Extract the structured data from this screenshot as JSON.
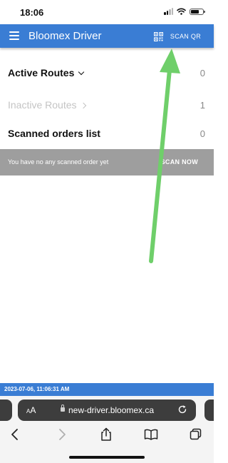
{
  "status_bar": {
    "time": "18:06",
    "icons": [
      "cellular-signal-icon",
      "wifi-icon",
      "battery-icon"
    ]
  },
  "app_bar": {
    "title": "Bloomex Driver",
    "menu_icon": "hamburger-menu-icon",
    "scan_qr_label": "SCAN QR",
    "scan_qr_icon": "qr-code-icon",
    "background_color": "#3a7dd4"
  },
  "routes": {
    "active": {
      "label": "Active Routes",
      "count": "0"
    },
    "inactive": {
      "label": "Inactive Routes",
      "count": "1"
    }
  },
  "scanned_orders": {
    "label": "Scanned orders list",
    "count": "0",
    "empty_message": "You have no any scanned order yet",
    "scan_now_label": "SCAN NOW"
  },
  "annotation": {
    "arrow_color": "#6fcf6a"
  },
  "timestamp": "2023-07-06, 11:06:31 AM",
  "browser": {
    "text_size_label": "AA",
    "url": "new-driver.bloomex.ca",
    "toolbar_icons": [
      "back-icon",
      "forward-icon",
      "share-icon",
      "bookmarks-icon",
      "tabs-icon"
    ]
  }
}
